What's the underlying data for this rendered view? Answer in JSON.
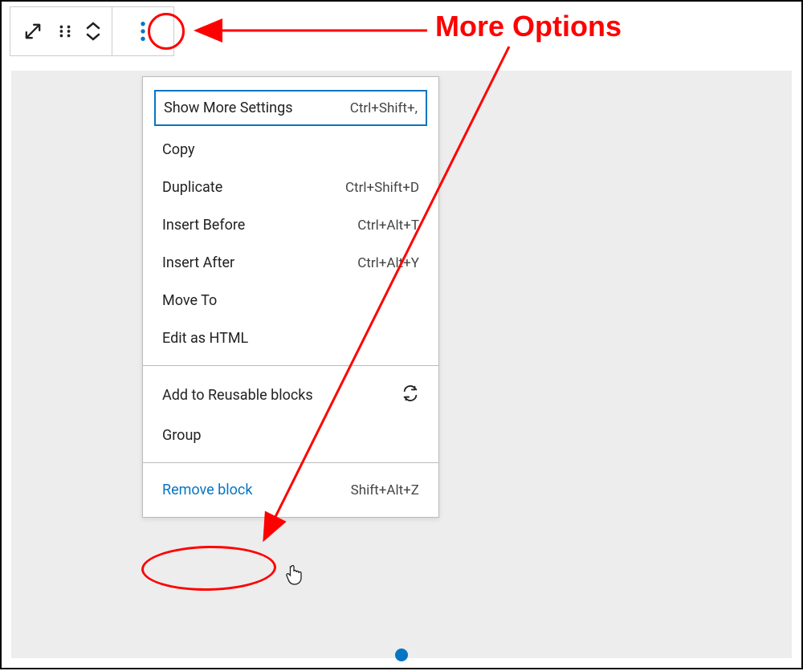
{
  "annotation": {
    "label": "More Options"
  },
  "menu": {
    "section1": {
      "showMore": {
        "label": "Show More Settings",
        "shortcut": "Ctrl+Shift+,"
      },
      "copy": {
        "label": "Copy"
      },
      "duplicate": {
        "label": "Duplicate",
        "shortcut": "Ctrl+Shift+D"
      },
      "insertBefore": {
        "label": "Insert Before",
        "shortcut": "Ctrl+Alt+T"
      },
      "insertAfter": {
        "label": "Insert After",
        "shortcut": "Ctrl+Alt+Y"
      },
      "moveTo": {
        "label": "Move To"
      },
      "editHTML": {
        "label": "Edit as HTML"
      }
    },
    "section2": {
      "addReusable": {
        "label": "Add to Reusable blocks"
      },
      "group": {
        "label": "Group"
      }
    },
    "section3": {
      "remove": {
        "label": "Remove block",
        "shortcut": "Shift+Alt+Z"
      }
    }
  }
}
